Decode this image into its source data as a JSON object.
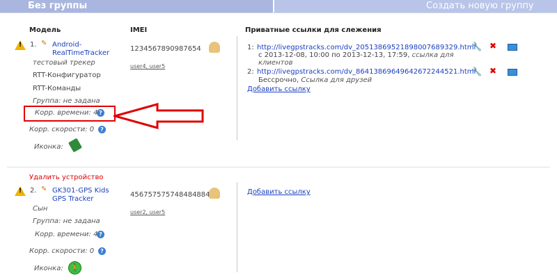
{
  "header": {
    "title": "Без группы",
    "create_group": "Создать новую группу"
  },
  "columns": {
    "model": "Модель",
    "imei": "IMEI",
    "links": "Приватные ссылки для слежения"
  },
  "devices": [
    {
      "number": "1.",
      "name": "Android-RealTimeTracker",
      "subtitle": "тестовый трекер",
      "actions": [
        "RTT-Конфигуратор",
        "RTT-Команды"
      ],
      "group": "Группа: не задана",
      "time_corr": "Корр. времени: 4",
      "speed_corr": "Корр. скорости: 0",
      "icon_label": "Иконка:",
      "imei": "1234567890987654",
      "users": "user4, user5",
      "links": [
        {
          "num": "1:",
          "url": "http://livegpstracks.com/dv_205138695218980076893​29.html",
          "details": "с 2013-12-08, 10:00 по 2013-12-13, 17:59,",
          "details_italic": "ссылка для клиентов"
        },
        {
          "num": "2:",
          "url": "http://livegpstracks.com/dv_864138696496426722445​21.html",
          "details": "Бессрочно,",
          "details_italic": "Ссылка для друзей"
        }
      ],
      "add_link": "Добавить ссылку",
      "delete": "Удалить устройство"
    },
    {
      "number": "2.",
      "name": "GK301-GPS Kids GPS Tracker",
      "subtitle": "Сын",
      "group": "Группа: не задана",
      "time_corr": "Корр. времени: 4",
      "speed_corr": "Корр. скорости: 0",
      "icon_label": "Иконка:",
      "imei": "4567575757484848848",
      "users": "user2, user5",
      "add_link": "Добавить ссылку"
    }
  ],
  "colors": {
    "header_bg": "#b8c4e8",
    "link": "#1a3fbf",
    "highlight": "#e00000",
    "warning": "#f0b400"
  }
}
